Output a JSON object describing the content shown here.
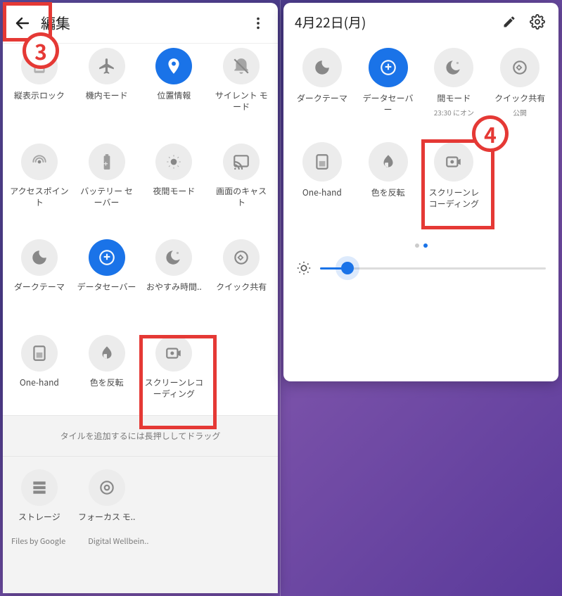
{
  "left": {
    "header": {
      "title": "編集"
    },
    "tiles_main": [
      {
        "id": "rotation-lock",
        "label": "縦表示ロック"
      },
      {
        "id": "airplane",
        "label": "機内モード"
      },
      {
        "id": "location",
        "label": "位置情報",
        "active": true
      },
      {
        "id": "silent",
        "label": "サイレント モ\nード"
      },
      {
        "id": "hotspot",
        "label": "アクセスポイン\nト"
      },
      {
        "id": "battery-saver",
        "label": "バッテリー セ\nーバー"
      },
      {
        "id": "night-mode",
        "label": "夜間モード"
      },
      {
        "id": "cast",
        "label": "画面のキャス\nト"
      },
      {
        "id": "dark-theme",
        "label": "ダークテーマ"
      },
      {
        "id": "data-saver",
        "label": "データセーバー",
        "active": true
      },
      {
        "id": "bedtime",
        "label": "おやすみ時間.."
      },
      {
        "id": "quick-share",
        "label": "クイック共有"
      },
      {
        "id": "one-hand",
        "label": "One-hand"
      },
      {
        "id": "invert-colors",
        "label": "色を反転"
      },
      {
        "id": "screen-record",
        "label": "スクリーンレコ\nーディング"
      }
    ],
    "drag_hint": "タイルを追加するには長押ししてドラッグ",
    "tiles_extra": [
      {
        "id": "storage",
        "label": "ストレージ"
      },
      {
        "id": "focus-mode",
        "label": "フォーカス モ.."
      }
    ],
    "attribution": [
      "Files by Google",
      "Digital Wellbein.."
    ]
  },
  "right": {
    "date": "4月22日(月)",
    "tiles": [
      {
        "id": "dark-theme",
        "label": "ダークテーマ"
      },
      {
        "id": "data-saver",
        "label": "データセーバ\nー",
        "active": true
      },
      {
        "id": "bedtime",
        "label": "間モード",
        "sub": "23:30 にオン"
      },
      {
        "id": "quick-share",
        "label": "クイック共有",
        "sub": "公開"
      },
      {
        "id": "one-hand",
        "label": "One-hand"
      },
      {
        "id": "invert-colors",
        "label": "色を反転"
      },
      {
        "id": "screen-record",
        "label": "スクリーンレ\nコーディング"
      }
    ],
    "brightness_pct": 12,
    "page": {
      "current": 2,
      "total": 2
    }
  },
  "callouts": {
    "c3": "3",
    "c4": "4"
  },
  "colors": {
    "accent": "#1a73e8",
    "callout": "#E53935"
  }
}
